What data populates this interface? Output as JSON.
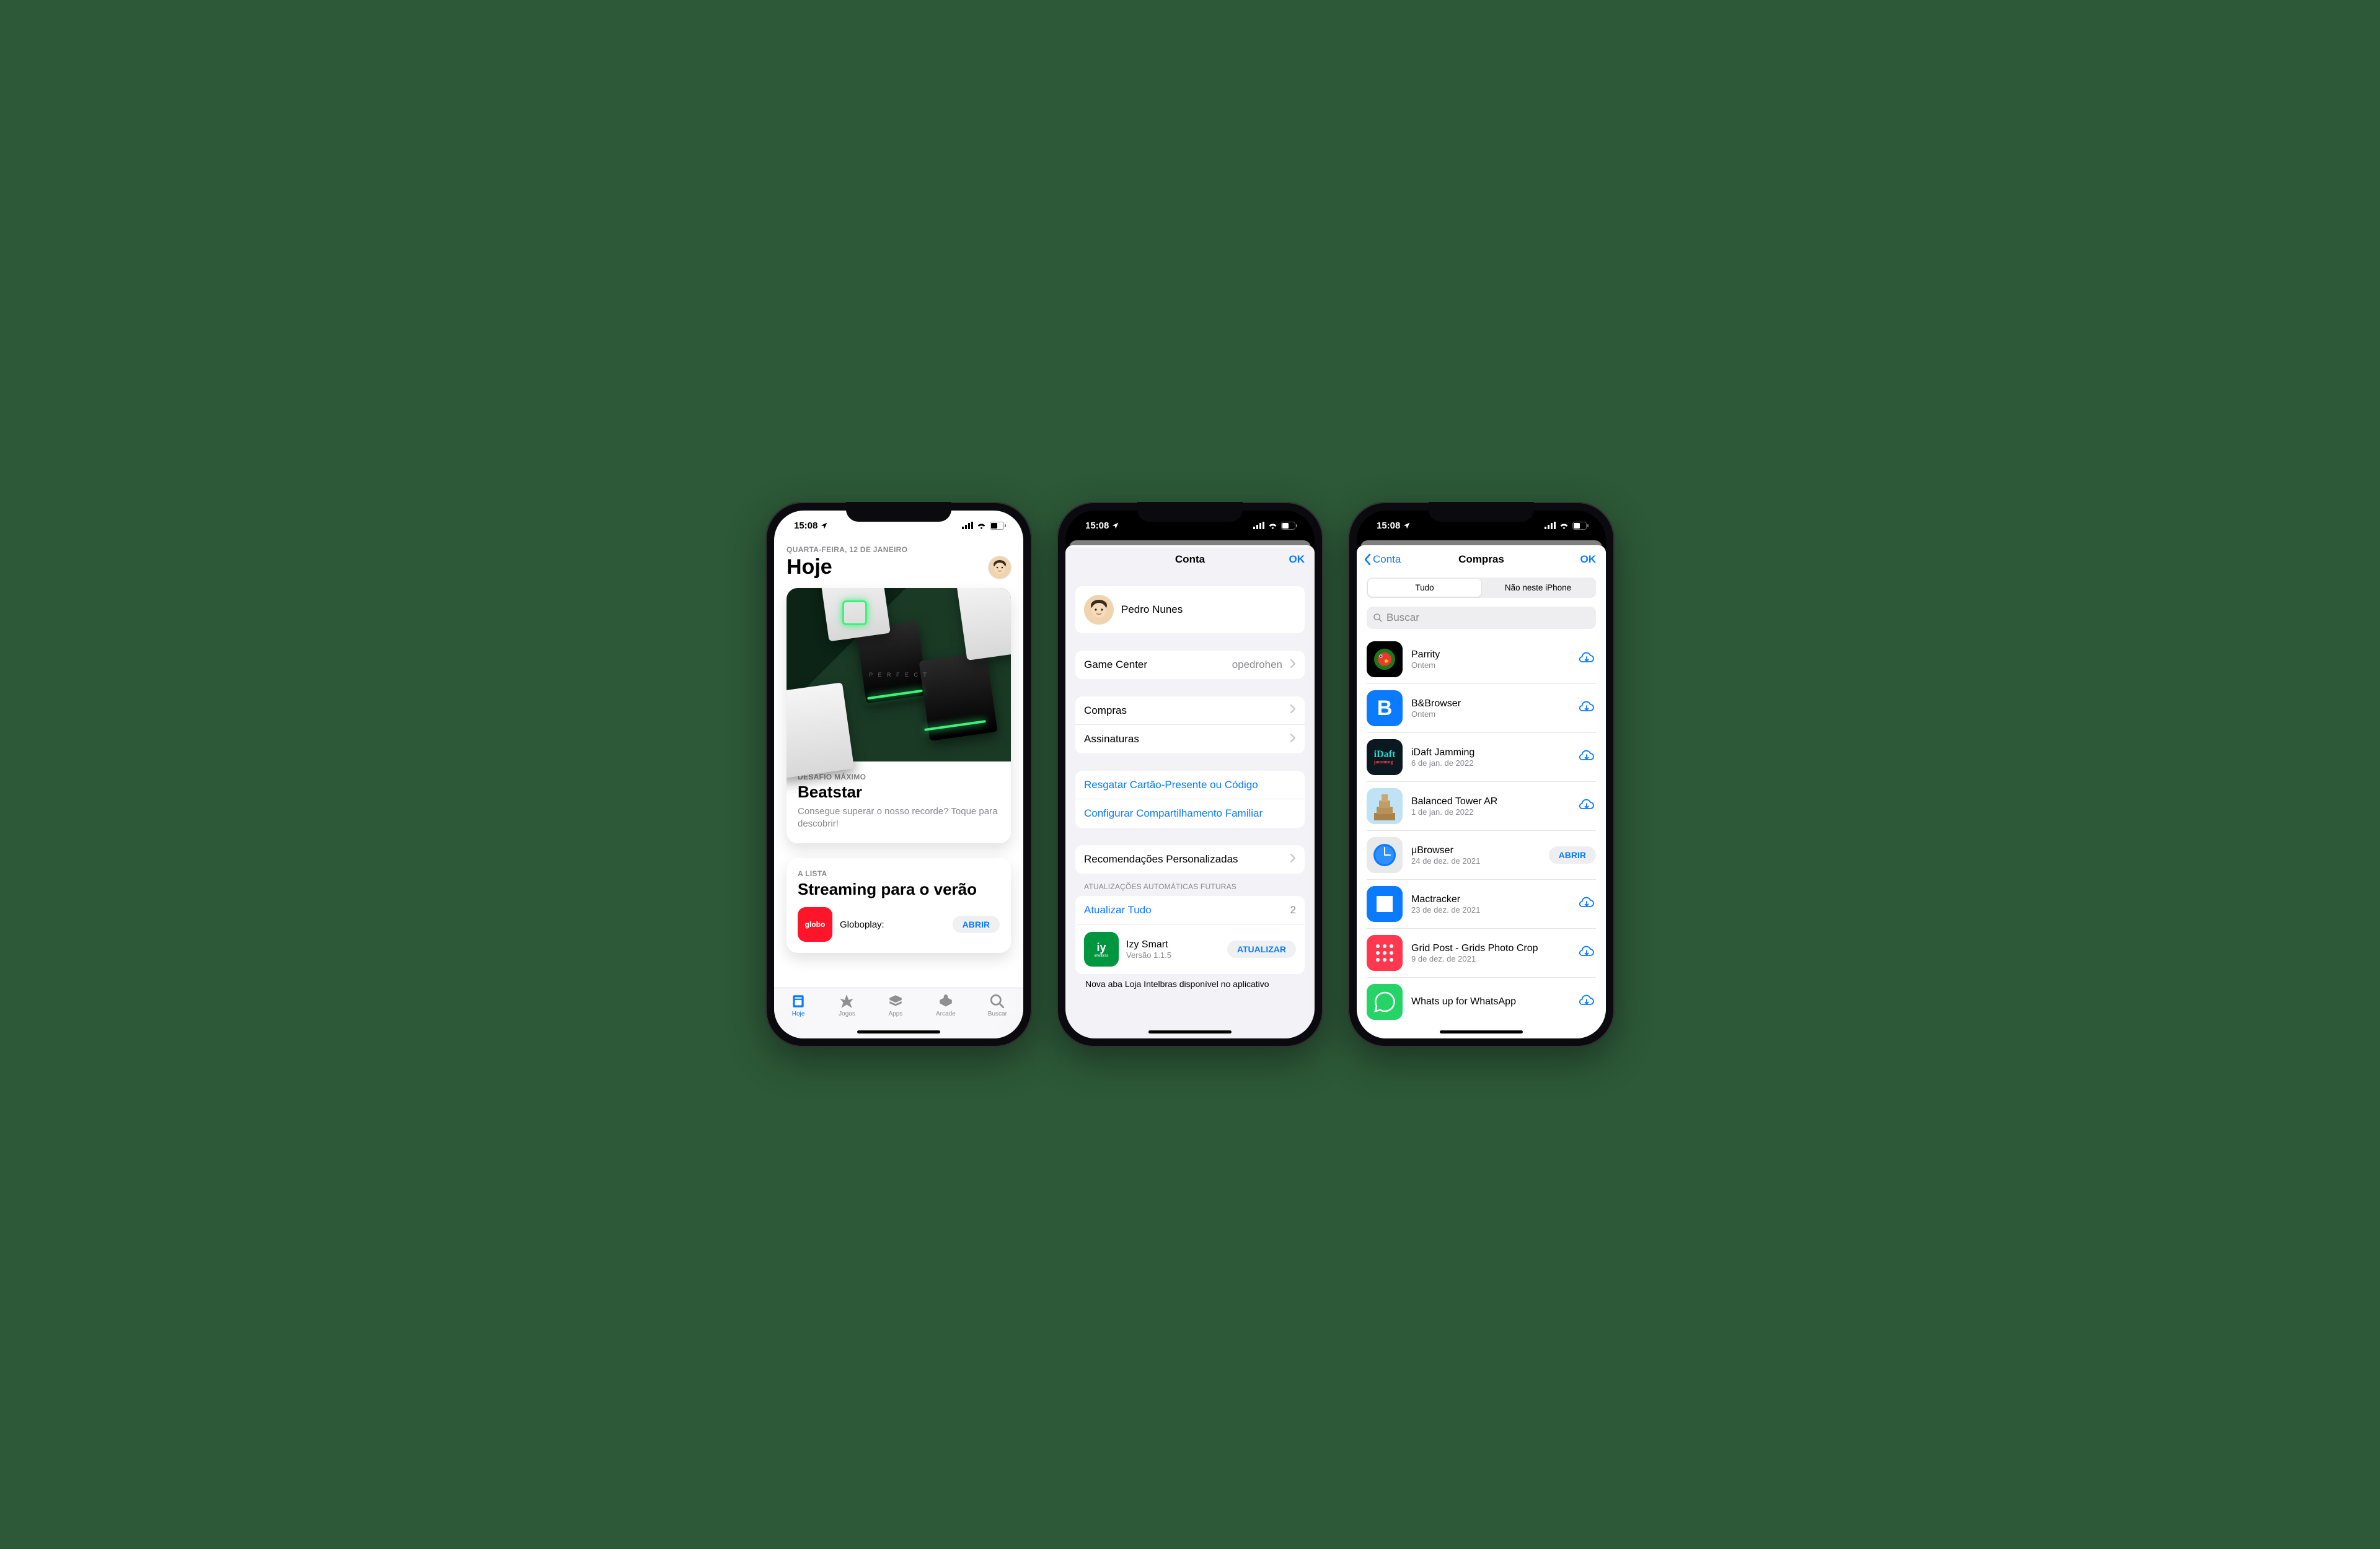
{
  "status": {
    "time": "15:08"
  },
  "screen1": {
    "date_label": "QUARTA-FEIRA, 12 DE JANEIRO",
    "title": "Hoje",
    "card": {
      "eyebrow": "DESAFIO MÁXIMO",
      "title": "Beatstar",
      "desc": "Consegue superar o nosso recorde? Toque para descobrir!",
      "perfect": "P E R F E C T"
    },
    "list_card": {
      "eyebrow": "A LISTA",
      "title": "Streaming para o verão",
      "app": {
        "icon_text": "globo",
        "name": "Globoplay:",
        "action": "ABRIR"
      }
    },
    "tabs": {
      "hoje": "Hoje",
      "jogos": "Jogos",
      "apps": "Apps",
      "arcade": "Arcade",
      "buscar": "Buscar"
    }
  },
  "screen2": {
    "nav_title": "Conta",
    "nav_ok": "OK",
    "profile_name": "Pedro Nunes",
    "gamecenter": {
      "label": "Game Center",
      "value": "opedrohen"
    },
    "compras": "Compras",
    "assinaturas": "Assinaturas",
    "resgatar": "Resgatar Cartão-Presente ou Código",
    "compartilhamento": "Configurar Compartilhamento Familiar",
    "recomendacoes": "Recomendações Personalizadas",
    "updates_header": "ATUALIZAÇÕES AUTOMÁTICAS FUTURAS",
    "update_all": "Atualizar Tudo",
    "update_count": "2",
    "izy": {
      "name": "Izy Smart",
      "version": "Versão 1.1.5",
      "action": "ATUALIZAR",
      "icon_top": "iy",
      "icon_bottom": "intelbras"
    },
    "notes_trunc": "Nova aba Loja Intelbras disponível no aplicativo"
  },
  "screen3": {
    "nav_back": "Conta",
    "nav_title": "Compras",
    "nav_ok": "OK",
    "seg_all": "Tudo",
    "seg_not": "Não neste iPhone",
    "search_placeholder": "Buscar",
    "open_label": "ABRIR",
    "items": [
      {
        "name": "Parrity",
        "date": "Ontem",
        "action": "cloud",
        "icon_bg": "#000"
      },
      {
        "name": "B&Browser",
        "date": "Ontem",
        "action": "cloud",
        "icon_bg": "#0a7aff",
        "icon_text": "B"
      },
      {
        "name": "iDaft Jamming",
        "date": "6 de jan. de 2022",
        "action": "cloud",
        "icon_bg": "#0a1820"
      },
      {
        "name": "Balanced Tower AR",
        "date": "1 de jan. de 2022",
        "action": "cloud",
        "icon_bg": "#d9c29a"
      },
      {
        "name": "μBrowser",
        "date": "24 de dez. de 2021",
        "action": "open",
        "icon_bg": "#e8e9eb"
      },
      {
        "name": "Mactracker",
        "date": "23 de dez. de 2021",
        "action": "cloud",
        "icon_bg": "#0a7aff"
      },
      {
        "name": "Grid Post - Grids Photo Crop",
        "date": "9 de dez. de 2021",
        "action": "cloud",
        "icon_bg": "#ff3850"
      },
      {
        "name": "Whats up for WhatsApp",
        "date": "",
        "action": "cloud",
        "icon_bg": "#25d366"
      }
    ]
  }
}
